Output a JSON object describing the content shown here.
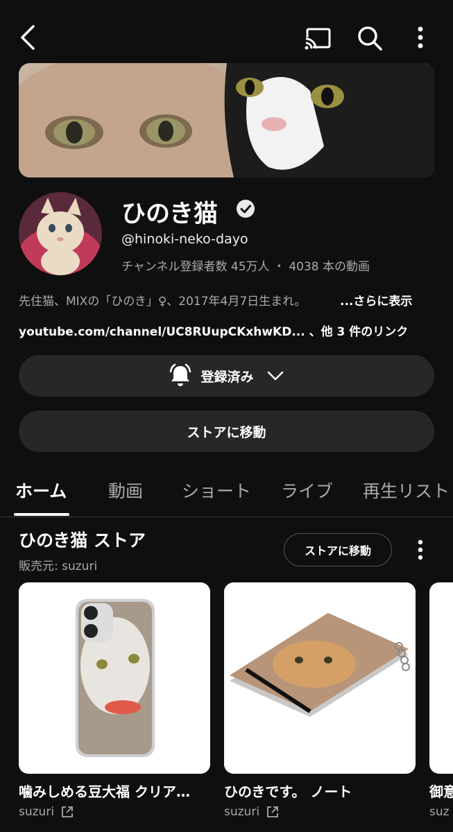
{
  "topbar": {
    "back_icon": "arrow-back-icon",
    "cast_icon": "cast-icon",
    "search_icon": "search-icon",
    "more_icon": "more-vertical-icon"
  },
  "channel": {
    "name": "ひのき猫",
    "handle": "@hinoki-neko-dayo",
    "stats": "チャンネル登録者数 45万人 ・ 4038 本の動画",
    "description": "先住猫、MIXの「ひのき」♀、2017年4月7日生まれ。",
    "description_more": "...さらに表示",
    "links": "youtube.com/channel/UC8RUupCKxhwKD... 、他 3 件のリンク"
  },
  "buttons": {
    "subscribed": "登録済み",
    "go_to_store": "ストアに移動"
  },
  "tabs": [
    {
      "label": "ホーム",
      "active": true
    },
    {
      "label": "動画",
      "active": false
    },
    {
      "label": "ショート",
      "active": false
    },
    {
      "label": "ライブ",
      "active": false
    },
    {
      "label": "再生リスト",
      "active": false
    }
  ],
  "store": {
    "title": "ひのき猫 ストア",
    "seller": "販売元: suzuri",
    "go_button": "ストアに移動",
    "products": [
      {
        "name": "噛みしめる豆大福 クリア…",
        "seller": "suzuri"
      },
      {
        "name": "ひのきです。 ノート",
        "seller": "suzuri"
      },
      {
        "name": "御意",
        "seller": "suz"
      }
    ]
  },
  "colors": {
    "background": "#0f0f0f",
    "pill": "#272727",
    "text_secondary": "#aaaaaa"
  }
}
